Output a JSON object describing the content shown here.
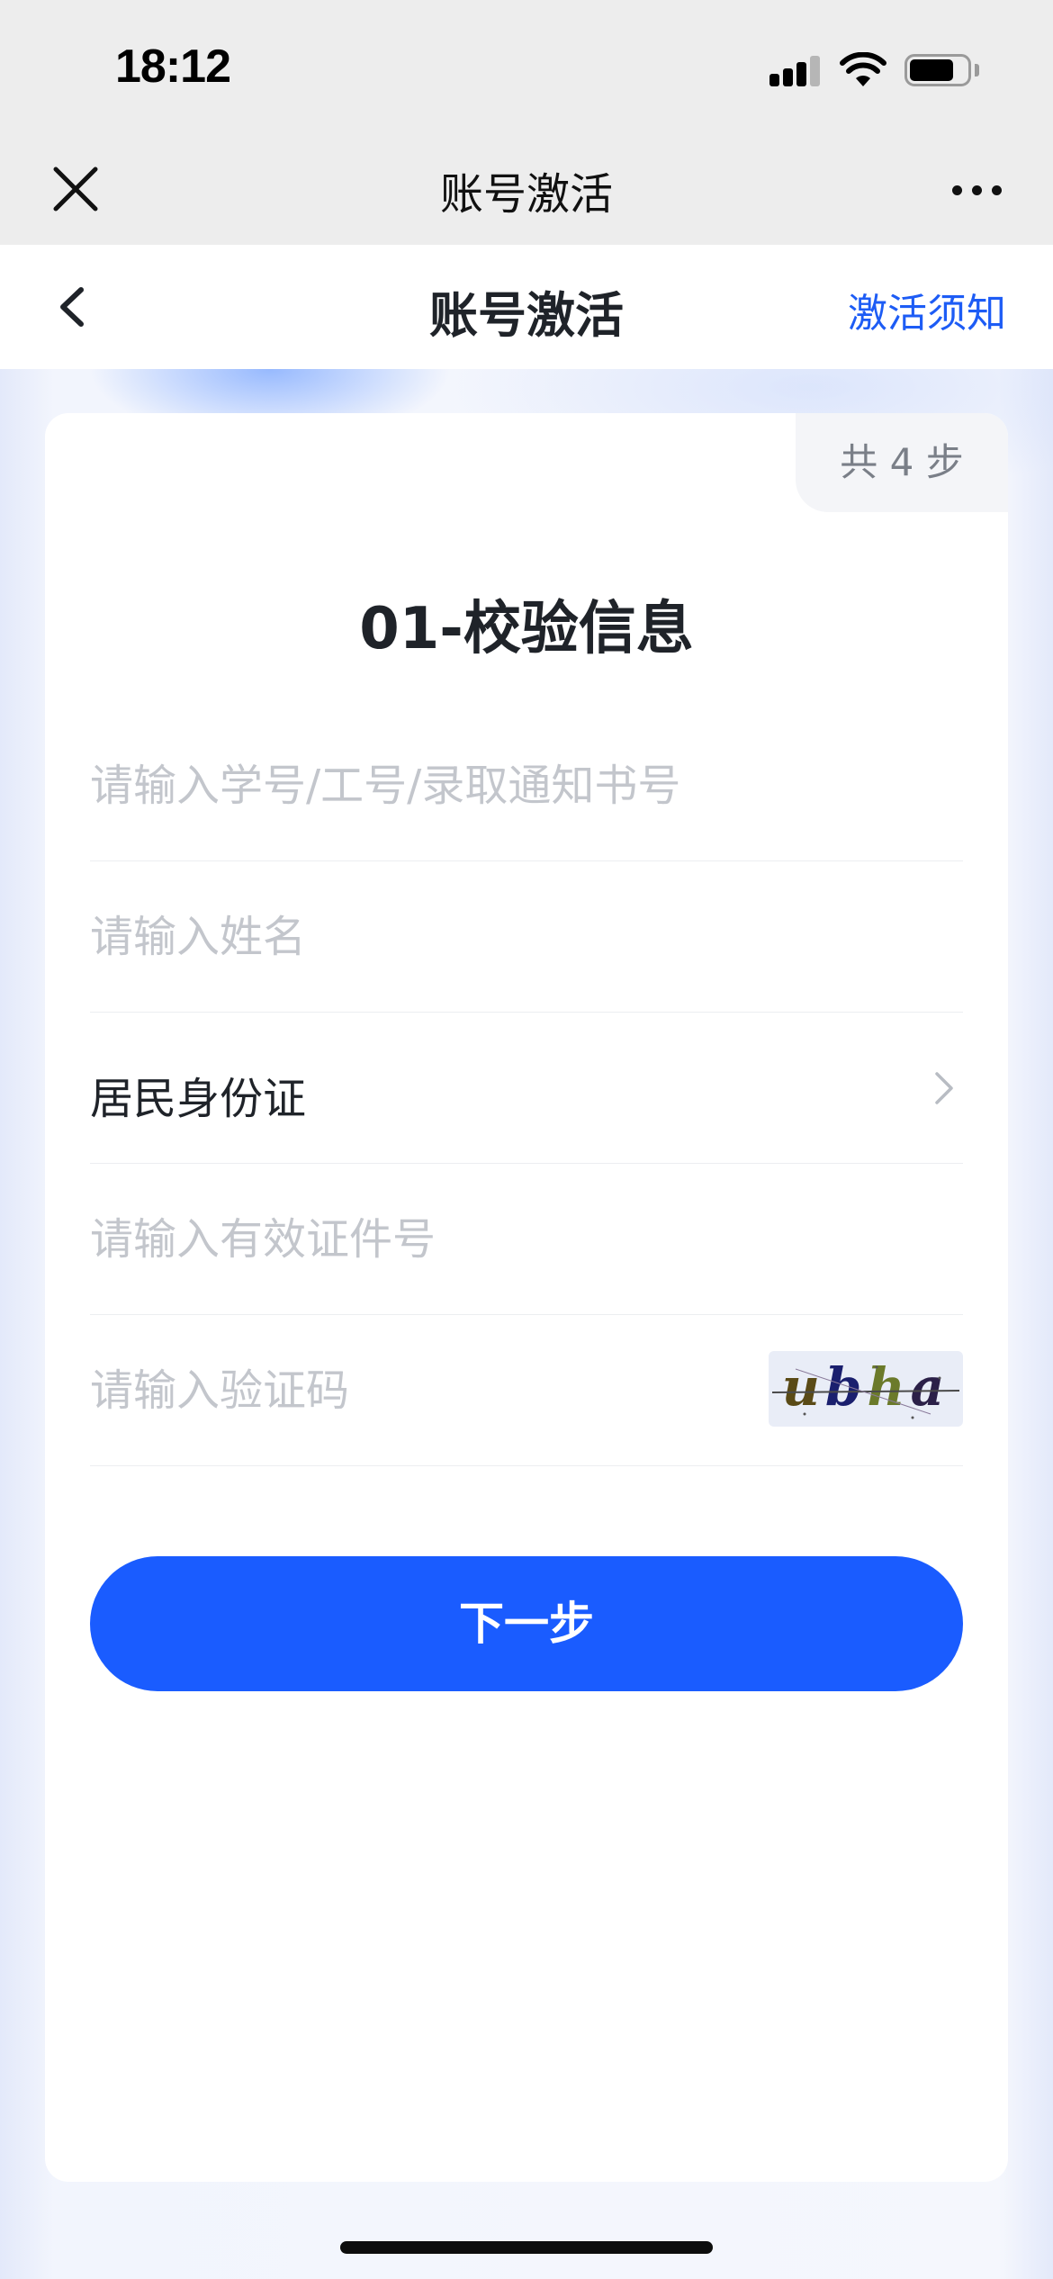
{
  "status_bar": {
    "time": "18:12",
    "signal_icon": "cellular-signal-icon",
    "wifi_icon": "wifi-icon",
    "battery_icon": "battery-icon",
    "battery_level": 0.7
  },
  "webview": {
    "title": "账号激活",
    "close_icon": "close-icon",
    "more_icon": "more-icon"
  },
  "nav": {
    "title": "账号激活",
    "notice_link": "激活须知",
    "back_icon": "chevron-left-icon"
  },
  "card": {
    "step_badge": "共 4 步",
    "step_title": "01-校验信息",
    "fields": {
      "student_id_placeholder": "请输入学号/工号/录取通知书号",
      "name_placeholder": "请输入姓名",
      "id_type_value": "居民身份证",
      "id_number_placeholder": "请输入有效证件号",
      "captcha_placeholder": "请输入验证码",
      "captcha_text": [
        "u",
        "b",
        "h",
        "a"
      ]
    },
    "next_button": "下一步"
  },
  "colors": {
    "accent": "#1a5cff",
    "link": "#1d5cf5",
    "header_bg": "#ededed",
    "placeholder": "#c3c6cc"
  }
}
